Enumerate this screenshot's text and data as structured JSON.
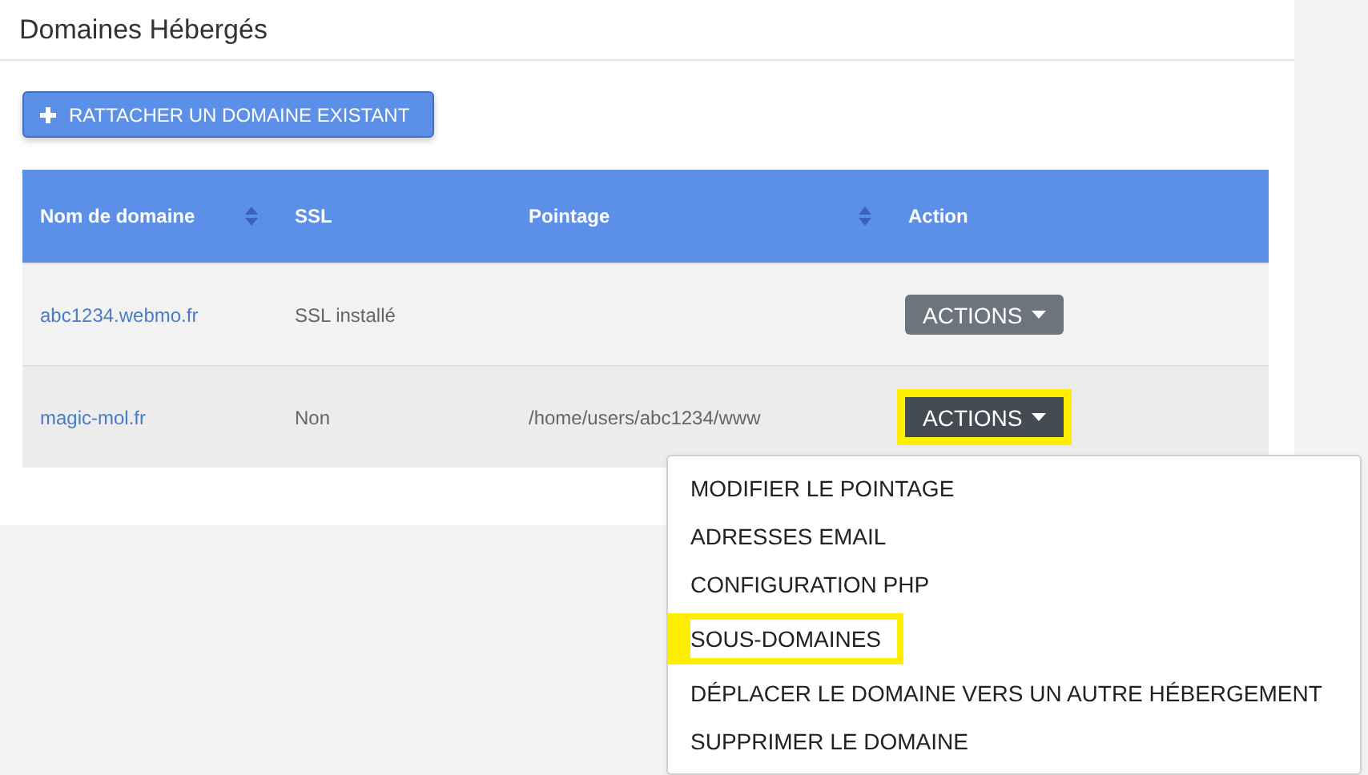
{
  "panel": {
    "title": "Domaines Hébergés"
  },
  "attach_button": {
    "label": "RATTACHER UN DOMAINE EXISTANT"
  },
  "table": {
    "columns": [
      {
        "label": "Nom de domaine",
        "sortable": true
      },
      {
        "label": "SSL",
        "sortable": false
      },
      {
        "label": "Pointage",
        "sortable": true
      },
      {
        "label": "Action",
        "sortable": false
      }
    ],
    "rows": [
      {
        "domain": "abc1234.webmo.fr",
        "ssl": "SSL installé",
        "pointage": null,
        "action": "ACTIONS",
        "open": false,
        "highlighted": false
      },
      {
        "domain": "magic-mol.fr",
        "ssl": "Non",
        "pointage": "/home/users/abc1234/www",
        "action": "ACTIONS",
        "open": true,
        "highlighted": true
      }
    ]
  },
  "menu": {
    "items": [
      {
        "label": "MODIFIER LE POINTAGE",
        "highlighted": false
      },
      {
        "label": "ADRESSES EMAIL",
        "highlighted": false
      },
      {
        "label": "CONFIGURATION PHP",
        "highlighted": false
      },
      {
        "label": "SOUS-DOMAINES",
        "highlighted": true
      },
      {
        "label": "DÉPLACER LE DOMAINE VERS UN AUTRE HÉBERGEMENT",
        "highlighted": false
      },
      {
        "label": "SUPPRIMER LE DOMAINE",
        "highlighted": false
      }
    ]
  }
}
